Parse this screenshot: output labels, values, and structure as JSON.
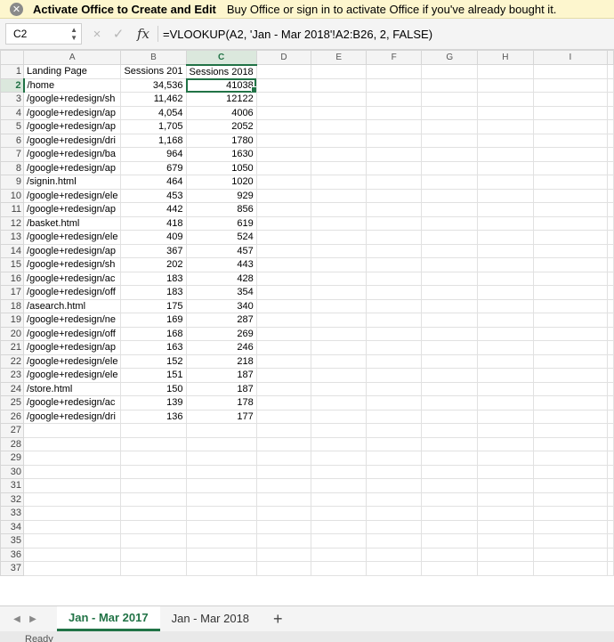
{
  "banner": {
    "bold": "Activate Office to Create and Edit",
    "message": "Buy Office or sign in to activate Office if you've already bought it."
  },
  "formula_bar": {
    "name_box": "C2",
    "cancel_icon": "×",
    "enter_icon": "✓",
    "fx": "fx",
    "formula": "=VLOOKUP(A2, 'Jan - Mar 2018'!A2:B26, 2, FALSE)"
  },
  "columns": [
    "A",
    "B",
    "C",
    "D",
    "E",
    "F",
    "G",
    "H",
    "I"
  ],
  "selected_column": "C",
  "selected_row": 2,
  "row_count": 37,
  "rows": [
    [
      "Landing Page",
      "Sessions 201",
      "Sessions 2018"
    ],
    [
      "/home",
      "34,536",
      "41038"
    ],
    [
      "/google+redesign/sh",
      "11,462",
      "12122"
    ],
    [
      "/google+redesign/ap",
      "4,054",
      "4006"
    ],
    [
      "/google+redesign/ap",
      "1,705",
      "2052"
    ],
    [
      "/google+redesign/dri",
      "1,168",
      "1780"
    ],
    [
      "/google+redesign/ba",
      "964",
      "1630"
    ],
    [
      "/google+redesign/ap",
      "679",
      "1050"
    ],
    [
      "/signin.html",
      "464",
      "1020"
    ],
    [
      "/google+redesign/ele",
      "453",
      "929"
    ],
    [
      "/google+redesign/ap",
      "442",
      "856"
    ],
    [
      "/basket.html",
      "418",
      "619"
    ],
    [
      "/google+redesign/ele",
      "409",
      "524"
    ],
    [
      "/google+redesign/ap",
      "367",
      "457"
    ],
    [
      "/google+redesign/sh",
      "202",
      "443"
    ],
    [
      "/google+redesign/ac",
      "183",
      "428"
    ],
    [
      "/google+redesign/off",
      "183",
      "354"
    ],
    [
      "/asearch.html",
      "175",
      "340"
    ],
    [
      "/google+redesign/ne",
      "169",
      "287"
    ],
    [
      "/google+redesign/off",
      "168",
      "269"
    ],
    [
      "/google+redesign/ap",
      "163",
      "246"
    ],
    [
      "/google+redesign/ele",
      "152",
      "218"
    ],
    [
      "/google+redesign/ele",
      "151",
      "187"
    ],
    [
      "/store.html",
      "150",
      "187"
    ],
    [
      "/google+redesign/ac",
      "139",
      "178"
    ],
    [
      "/google+redesign/dri",
      "136",
      "177"
    ]
  ],
  "sheet_tabs": {
    "nav_prev": "◀",
    "nav_next": "▶",
    "tabs": [
      "Jan - Mar 2017",
      "Jan - Mar 2018"
    ],
    "active_index": 0,
    "add": "+"
  },
  "status": "Ready",
  "colors": {
    "accent": "#217346",
    "banner_bg": "#fdf6ce"
  }
}
